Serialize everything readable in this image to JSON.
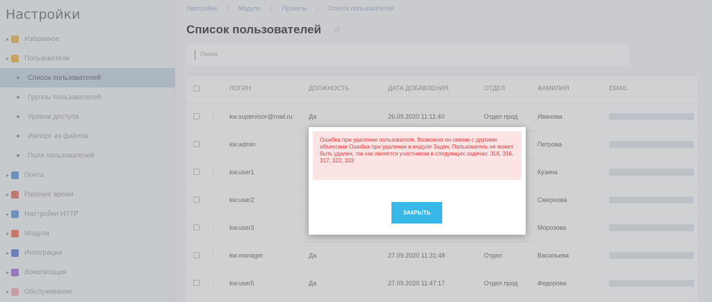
{
  "sidebar": {
    "title": "Настройки",
    "items": [
      {
        "label": "Избранное",
        "kind": "group",
        "icon": "star-icon",
        "color": "#e9b44c"
      },
      {
        "label": "Пользователи",
        "kind": "group",
        "icon": "users-icon",
        "color": "#f0b040"
      },
      {
        "label": "Список пользователей",
        "kind": "sub",
        "active": true
      },
      {
        "label": "Группы пользователей",
        "kind": "sub"
      },
      {
        "label": "Уровни доступа",
        "kind": "sub"
      },
      {
        "label": "Импорт из файлов",
        "kind": "sub"
      },
      {
        "label": "Поля пользователей",
        "kind": "sub"
      },
      {
        "label": "Почта",
        "kind": "group",
        "icon": "mail-icon",
        "color": "#5a8fd0"
      },
      {
        "label": "Рабочее время",
        "kind": "group",
        "icon": "clock-icon",
        "color": "#e06a5a"
      },
      {
        "label": "Настройки HTTP",
        "kind": "group",
        "icon": "globe-icon",
        "color": "#5a8fd0"
      },
      {
        "label": "Модули",
        "kind": "group",
        "icon": "puzzle-icon",
        "color": "#ec6b4f"
      },
      {
        "label": "Интеграции",
        "kind": "group",
        "icon": "plug-icon",
        "color": "#5a6fd0"
      },
      {
        "label": "Локализация",
        "kind": "group",
        "icon": "flag-icon",
        "color": "#9a6ad0"
      },
      {
        "label": "Обслуживание",
        "kind": "group",
        "icon": "wrench-icon",
        "color": "#f2a8b0"
      }
    ]
  },
  "breadcrumb": [
    "Настройки",
    "Модули",
    "Проекты",
    "Список пользователей"
  ],
  "page": {
    "title": "Список пользователей",
    "search_placeholder": "Поиск"
  },
  "table": {
    "columns": [
      "Логин",
      "Должность",
      "Дата добавления",
      "Отдел",
      "Фамилия",
      "Email"
    ],
    "rows": [
      {
        "login": "kw.supervisor@mail.ru",
        "pos": "Да",
        "date": "26.09.2020 11:11:40",
        "dept": "Отдел прод",
        "name": "Иванова"
      },
      {
        "login": "kw.admin",
        "pos": "",
        "date": "",
        "dept": "",
        "name": "Петрова"
      },
      {
        "login": "kw.user1",
        "pos": "",
        "date": "",
        "dept": "",
        "name": "Кузина"
      },
      {
        "login": "kw.user2",
        "pos": "",
        "date": "",
        "dept": "",
        "name": "Смирнова"
      },
      {
        "login": "kw.user3",
        "pos": "",
        "date": "",
        "dept": "",
        "name": "Морозова"
      },
      {
        "login": "kw.manager",
        "pos": "Да",
        "date": "27.09.2020 11:31:48",
        "dept": "Отдел",
        "name": "Васильева"
      },
      {
        "login": "kw.user5",
        "pos": "Да",
        "date": "27.09.2020 11:47:17",
        "dept": "Отдел прод",
        "name": "Федорова"
      }
    ]
  },
  "modal": {
    "error_text": "Ошибка при удалении пользователя. Возможно он связан с другими объектами Ошибка при удалении в модуле Задач. Пользователь не может быть удален, так как является участником в следующих задачах: 318, 316, 317, 322, 333",
    "close_label": "Закрыть"
  },
  "colors": {
    "error_bg": "#fde4e4",
    "error_text": "#e0393d",
    "button": "#38b7e9"
  }
}
